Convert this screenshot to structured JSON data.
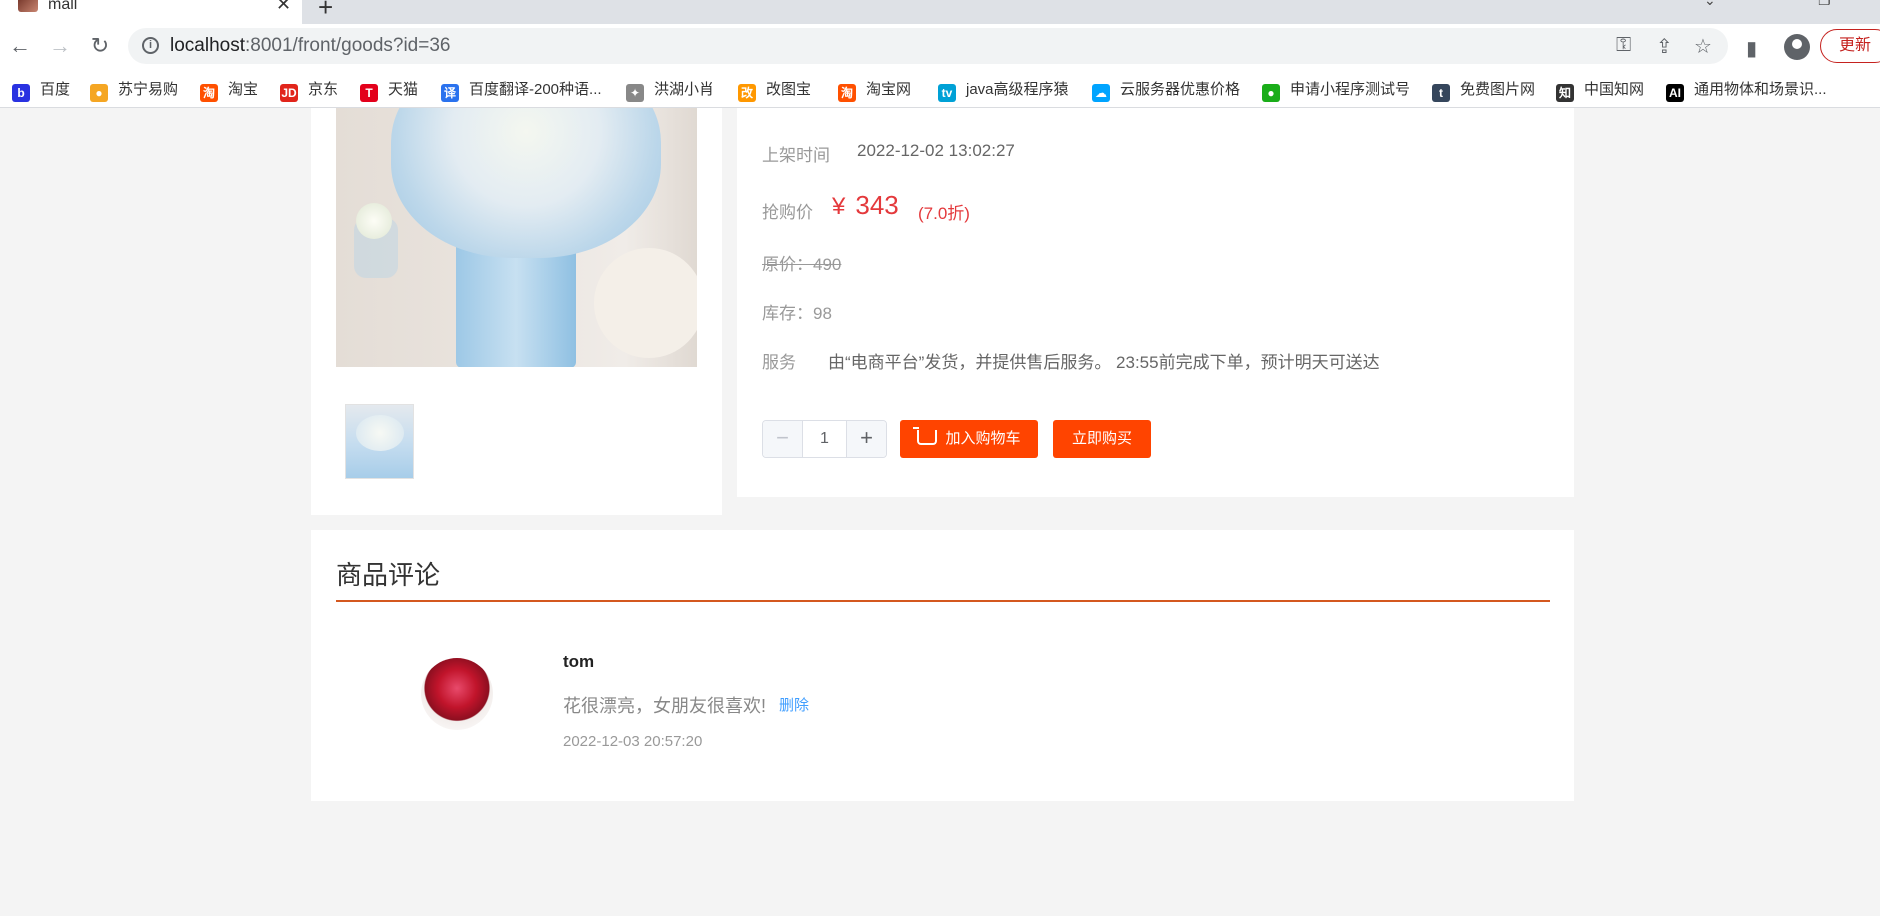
{
  "browser": {
    "tab_title": "mall",
    "url_host": "localhost",
    "url_path": ":8001/front/goods?id=36",
    "update_label": "更新"
  },
  "bookmarks": [
    {
      "label": "百度",
      "icon": "baidu-icon",
      "color": "#2932e1"
    },
    {
      "label": "苏宁易购",
      "icon": "suning-icon",
      "color": "#f5a623"
    },
    {
      "label": "淘宝",
      "icon": "taobao-icon",
      "color": "#ff5000"
    },
    {
      "label": "京东",
      "icon": "jd-icon",
      "color": "#e1251b"
    },
    {
      "label": "天猫",
      "icon": "tmall-icon",
      "color": "#e3001b"
    },
    {
      "label": "百度翻译-200种语...",
      "icon": "translate-icon",
      "color": "#2a72ee"
    },
    {
      "label": "洪湖小肖",
      "icon": "bookmark-icon",
      "color": "#888888"
    },
    {
      "label": "改图宝",
      "icon": "gaitubao-icon",
      "color": "#ff9800"
    },
    {
      "label": "淘宝网",
      "icon": "taobao-net-icon",
      "color": "#ff5000"
    },
    {
      "label": "java高级程序猿",
      "icon": "bilibili-icon",
      "color": "#00a1d6"
    },
    {
      "label": "云服务器优惠价格",
      "icon": "cloud-icon",
      "color": "#00a4ff"
    },
    {
      "label": "申请小程序测试号",
      "icon": "wechat-icon",
      "color": "#1aad19"
    },
    {
      "label": "免费图片网",
      "icon": "tumblr-icon",
      "color": "#35465c"
    },
    {
      "label": "中国知网",
      "icon": "cnki-icon",
      "color": "#333333"
    },
    {
      "label": "通用物体和场景识...",
      "icon": "ai-icon",
      "color": "#000000"
    }
  ],
  "product": {
    "listed_label": "上架时间",
    "listed_time": "2022-12-02 13:02:27",
    "price_label": "抢购价",
    "currency": "¥",
    "price": "343",
    "discount": "(7.0折)",
    "original_price": "原价：490",
    "stock": "库存：98",
    "service_label": "服务",
    "service_text": "由“电商平台”发货，并提供售后服务。 23:55前完成下单，预计明天可送达",
    "quantity": "1",
    "add_to_cart_label": "加入购物车",
    "buy_now_label": "立即购买"
  },
  "reviews": {
    "title": "商品评论",
    "items": [
      {
        "user": "tom",
        "content": "花很漂亮，女朋友很喜欢!",
        "delete_label": "删除",
        "time": "2022-12-03 20:57:20"
      }
    ]
  },
  "colors": {
    "accent": "#ff4400",
    "price": "#e4393c",
    "divider": "#d4581f",
    "link": "#409eff"
  }
}
